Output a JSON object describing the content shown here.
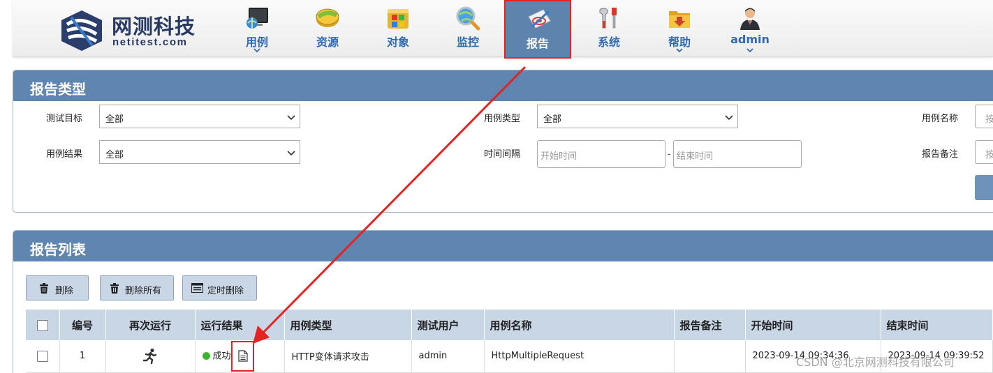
{
  "brand": {
    "name_cn": "网测科技",
    "name_en": "netitest.com"
  },
  "nav": [
    {
      "label": "用例",
      "icon": "monitor-globe-icon",
      "chevron": true,
      "active": false
    },
    {
      "label": "资源",
      "icon": "coins-icon",
      "chevron": false,
      "active": false
    },
    {
      "label": "对象",
      "icon": "windows-box-icon",
      "chevron": false,
      "active": false
    },
    {
      "label": "监控",
      "icon": "magnifier-globe-icon",
      "chevron": false,
      "active": false
    },
    {
      "label": "报告",
      "icon": "report-target-icon",
      "chevron": false,
      "active": true
    },
    {
      "label": "系统",
      "icon": "tools-icon",
      "chevron": false,
      "active": false
    },
    {
      "label": "帮助",
      "icon": "help-folder-icon",
      "chevron": true,
      "active": false
    },
    {
      "label": "admin",
      "icon": "user-avatar-icon",
      "chevron": true,
      "active": false
    }
  ],
  "report_type": {
    "title": "报告类型",
    "filters": {
      "test_target": {
        "label": "测试目标",
        "value": "全部"
      },
      "case_type": {
        "label": "用例类型",
        "value": "全部"
      },
      "case_name": {
        "label": "用例名称",
        "placeholder": "按"
      },
      "case_result": {
        "label": "用例结果",
        "value": "全部"
      },
      "time_range": {
        "label": "时间间隔",
        "start_placeholder": "开始时间",
        "separator": "-",
        "end_placeholder": "结束时间"
      },
      "report_note": {
        "label": "报告备注",
        "placeholder": "按"
      }
    }
  },
  "report_list": {
    "title": "报告列表",
    "toolbar": {
      "delete": "删除",
      "delete_all": "删除所有",
      "scheduled_delete": "定时删除"
    },
    "columns": [
      "编号",
      "再次运行",
      "运行结果",
      "用例类型",
      "测试用户",
      "用例名称",
      "报告备注",
      "开始时间",
      "结束时间"
    ],
    "rows": [
      {
        "id": "1",
        "result": "成功",
        "case_type": "HTTP变体请求攻击",
        "user": "admin",
        "case_name": "HttpMultipleRequest",
        "note": "",
        "start_time": "2023-09-14 09:34:36",
        "end_time": "2023-09-14 09:39:52"
      }
    ]
  },
  "watermark": "CSDN @北京网测科技有限公司",
  "colors": {
    "header_blue": "#5f86b0",
    "nav_text": "#2f6ab3",
    "annotation_red": "#e62222",
    "success_green": "#3db52f"
  }
}
